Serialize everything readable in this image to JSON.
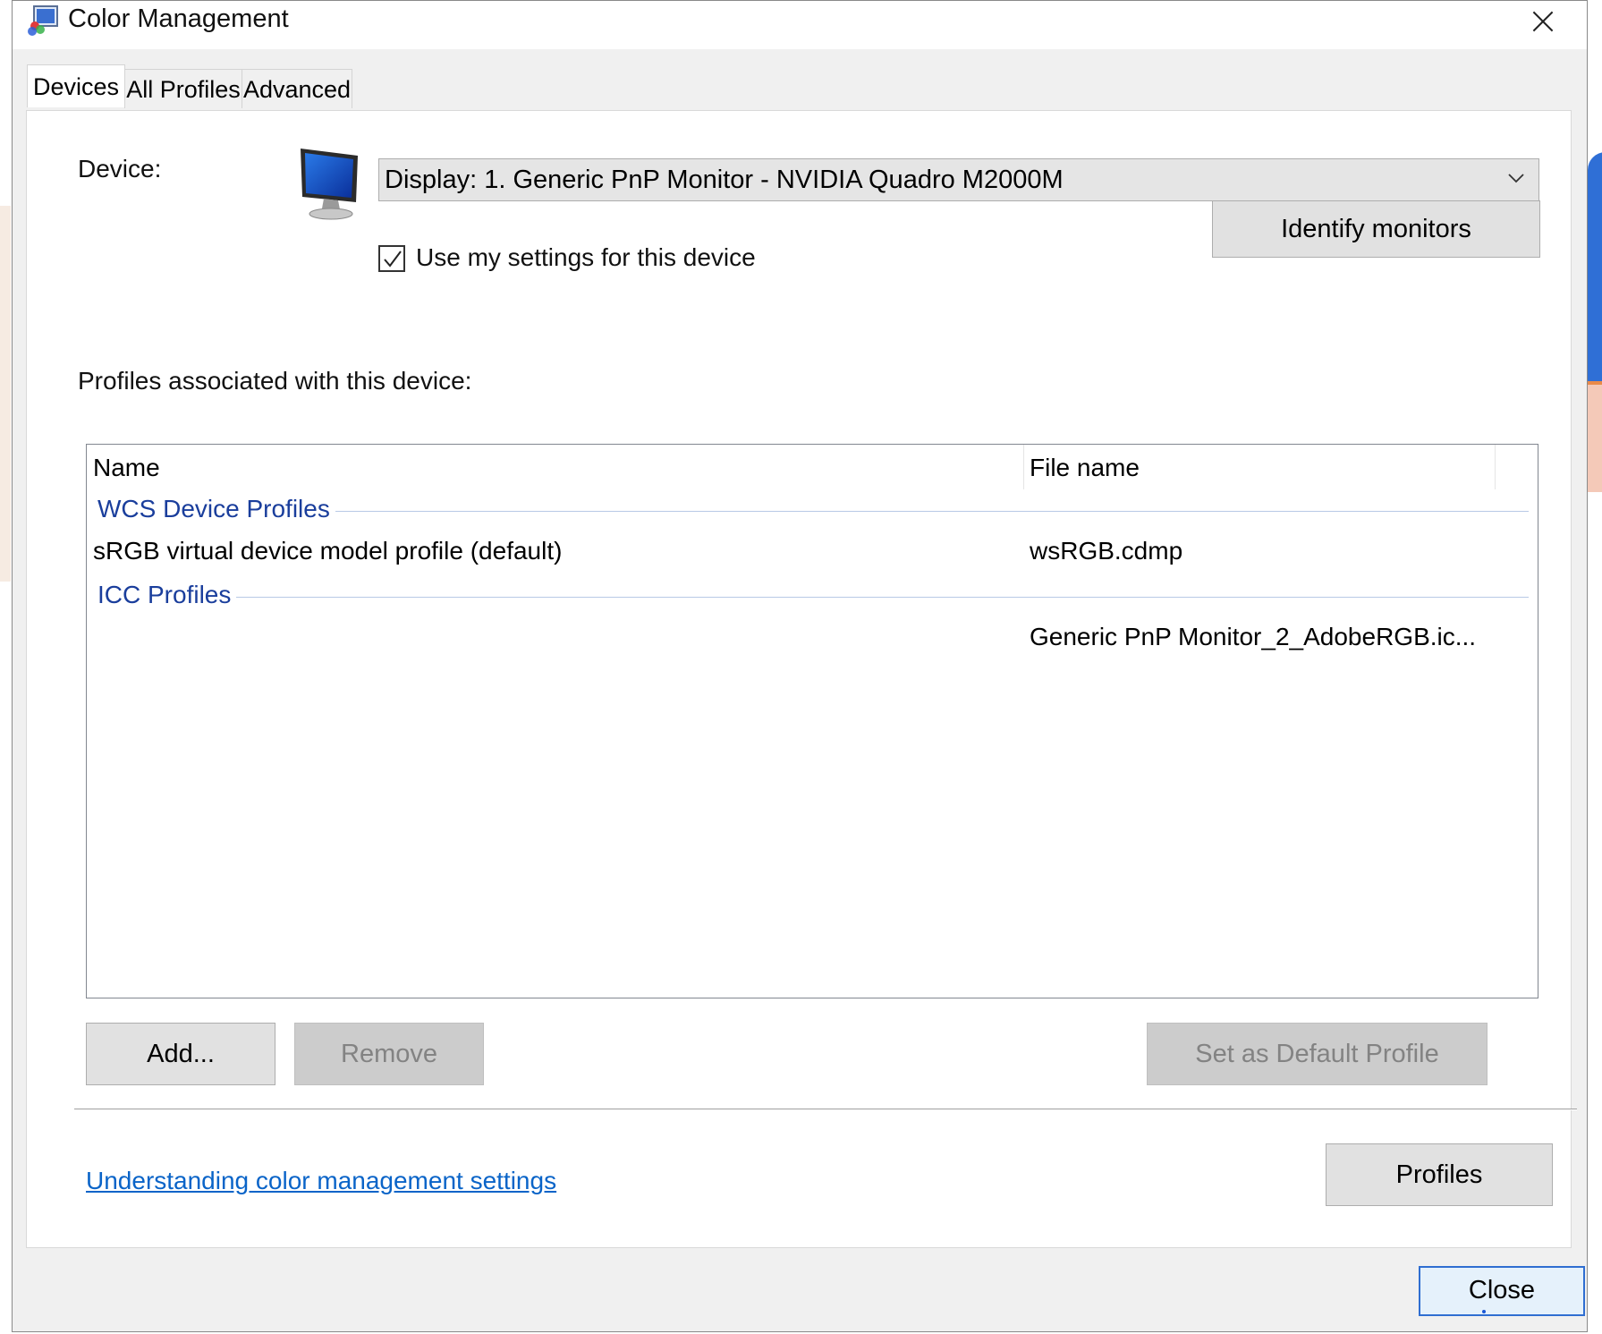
{
  "window": {
    "title": "Color Management",
    "close_icon": "close-icon"
  },
  "tabs": [
    {
      "label": "Devices",
      "active": true
    },
    {
      "label": "All Profiles",
      "active": false
    },
    {
      "label": "Advanced",
      "active": false
    }
  ],
  "devices": {
    "device_label": "Device:",
    "device_icon": "monitor-icon",
    "device_select_value": "Display: 1. Generic PnP Monitor - NVIDIA Quadro M2000M",
    "use_settings_label": "Use my settings for this device",
    "use_settings_checked": true,
    "identify_button": "Identify monitors",
    "profiles_label": "Profiles associated with this device:",
    "columns": [
      "Name",
      "File name"
    ],
    "groups": [
      {
        "header": "WCS Device Profiles",
        "rows": [
          {
            "name": "sRGB virtual device model profile (default)",
            "file": "wsRGB.cdmp"
          }
        ]
      },
      {
        "header": "ICC Profiles",
        "rows": [
          {
            "name": "",
            "file": "Generic PnP Monitor_2_AdobeRGB.ic..."
          }
        ]
      }
    ],
    "add_button": "Add...",
    "remove_button": "Remove",
    "remove_enabled": false,
    "set_default_button": "Set as Default Profile",
    "set_default_enabled": false,
    "link": "Understanding color management settings",
    "profiles_button": "Profiles"
  },
  "footer": {
    "close_button": "Close"
  },
  "colors": {
    "group_header": "#1a3e9c",
    "link": "#0a64c8",
    "focus_border": "#2f6ed1"
  }
}
